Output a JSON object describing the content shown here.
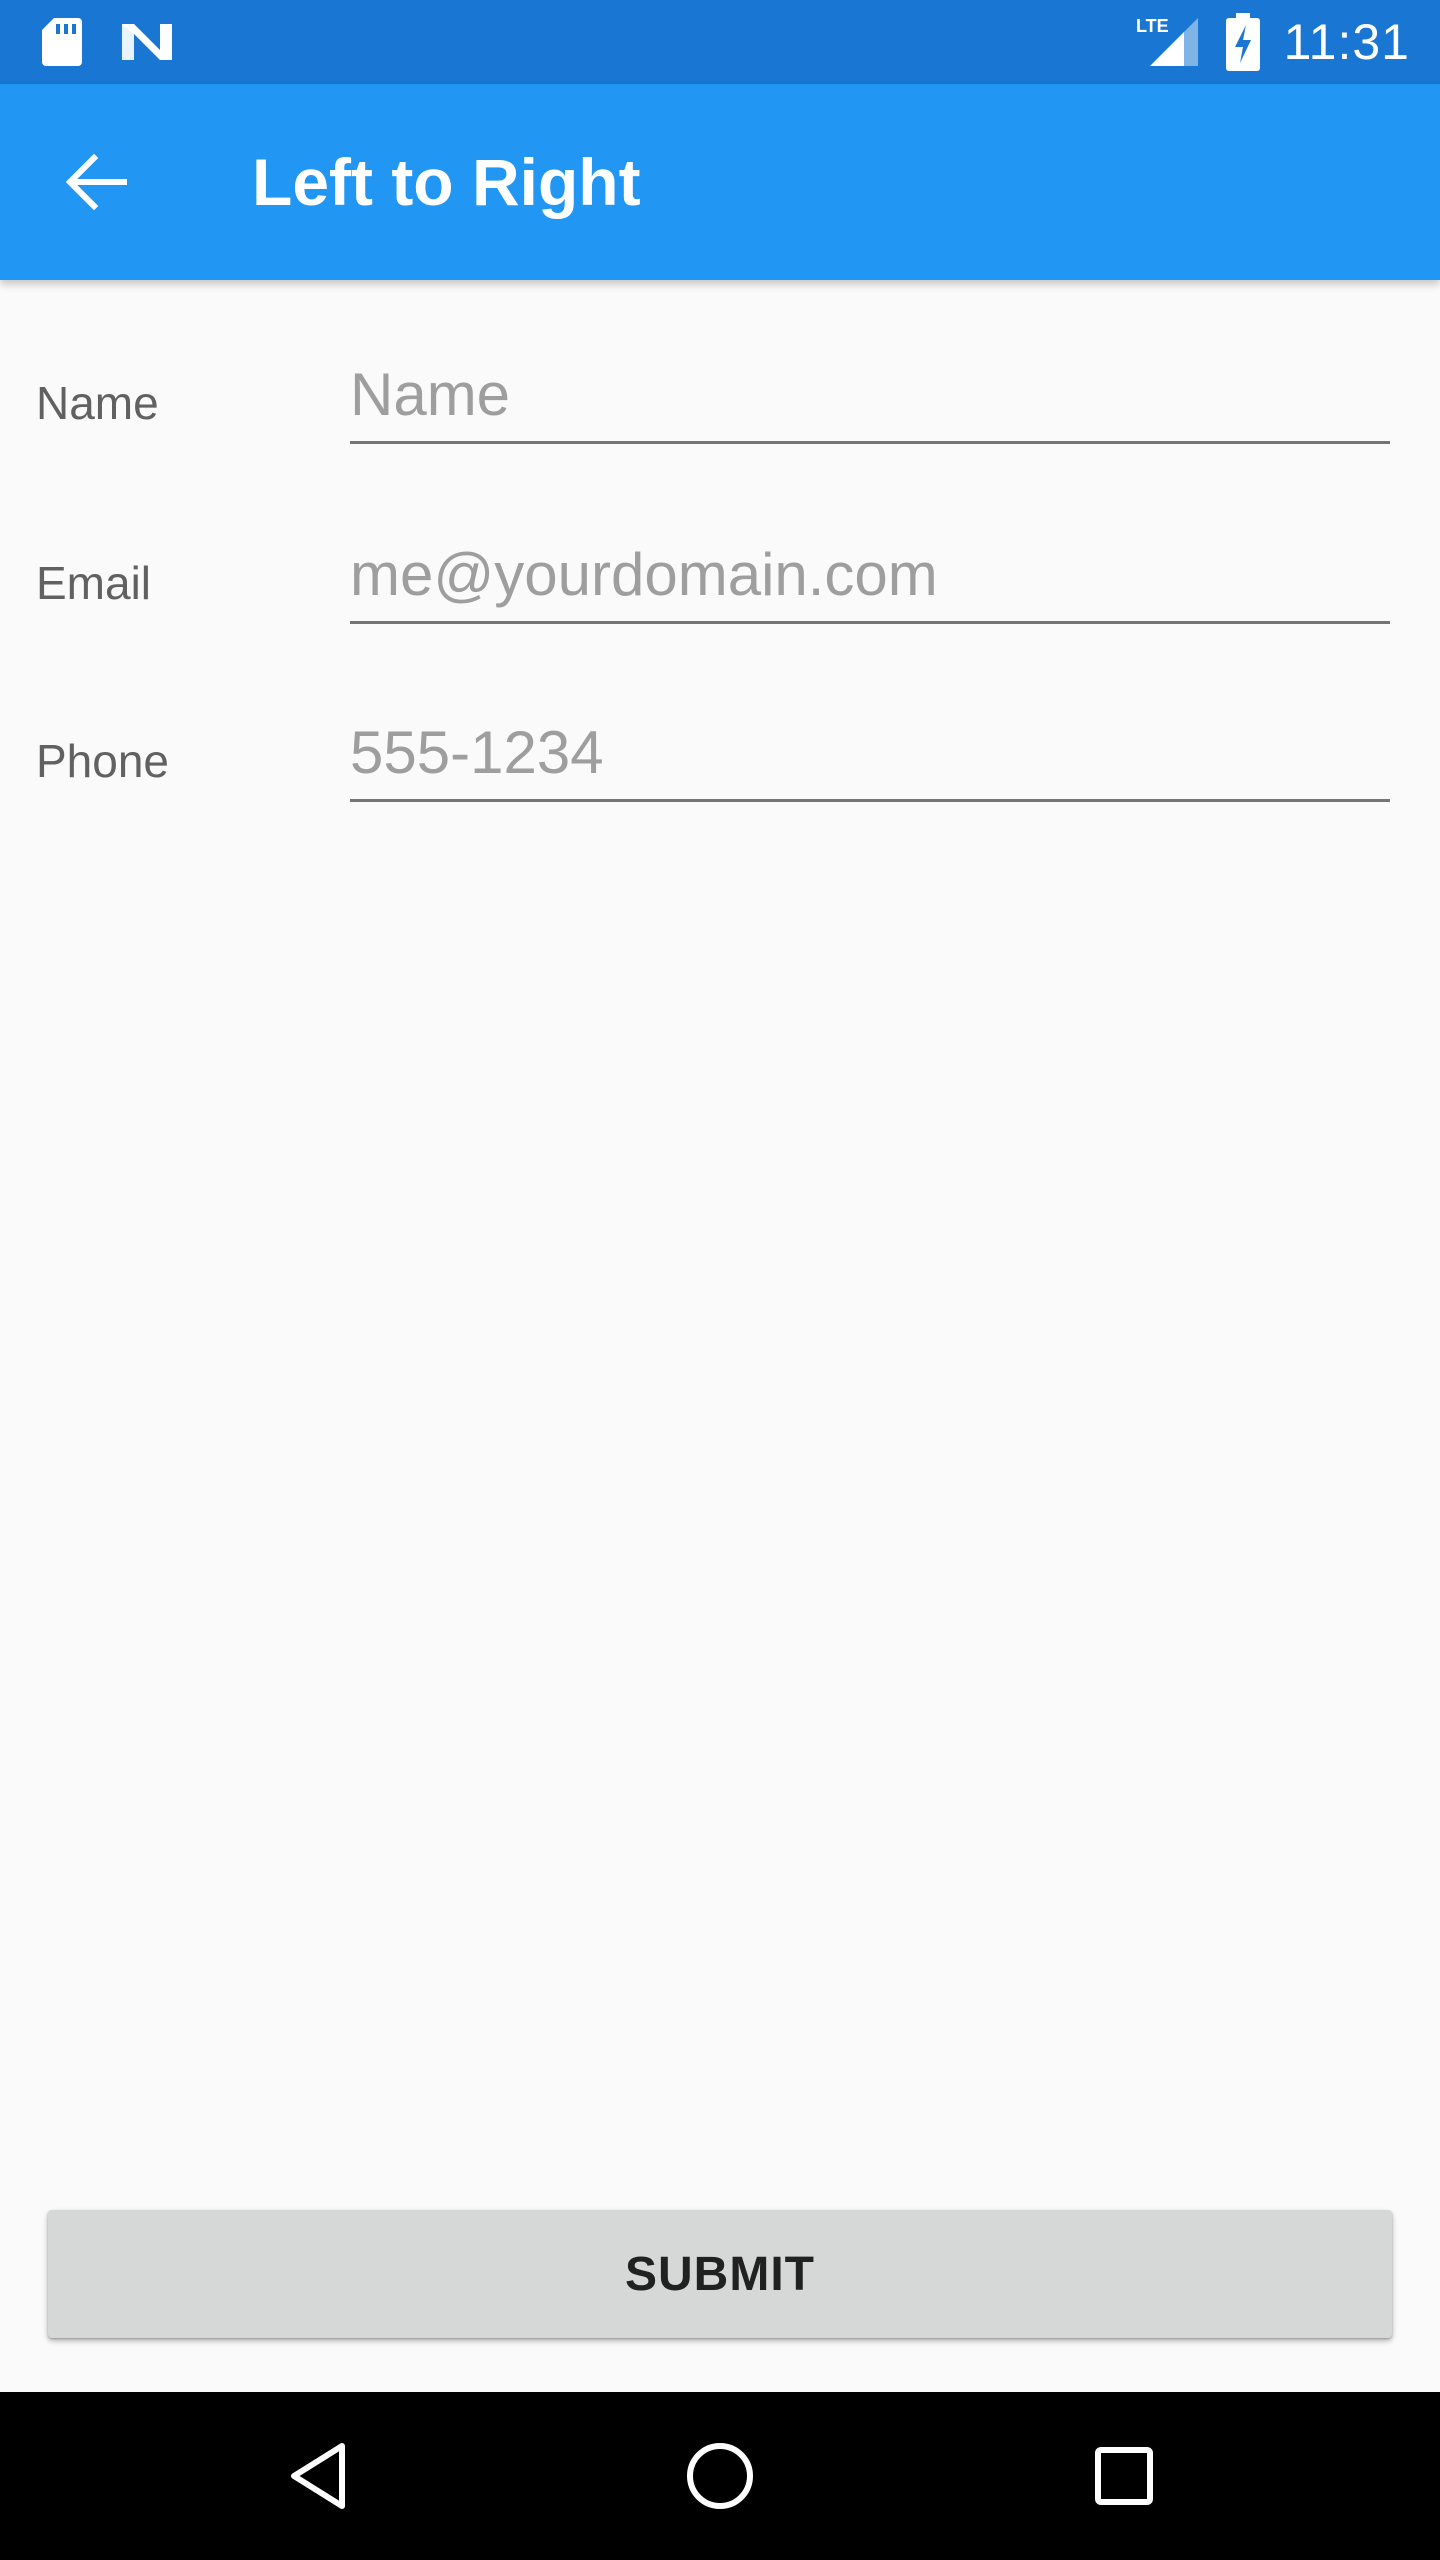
{
  "status_bar": {
    "time": "11:31",
    "network": "LTE",
    "icons": [
      "sd-card-icon",
      "notification-n-icon",
      "lte-signal-icon",
      "battery-charging-icon"
    ],
    "background": "#1976d2"
  },
  "app_bar": {
    "title": "Left to Right",
    "back_icon": "arrow-back-icon",
    "background": "#2196f3"
  },
  "form": {
    "fields": [
      {
        "label": "Name",
        "placeholder": "Name",
        "value": ""
      },
      {
        "label": "Email",
        "placeholder": "me@yourdomain.com",
        "value": ""
      },
      {
        "label": "Phone",
        "placeholder": "555-1234",
        "value": ""
      }
    ]
  },
  "submit": {
    "label": "SUBMIT"
  },
  "nav_bar": {
    "icons": [
      "back-triangle-icon",
      "home-circle-icon",
      "recents-square-icon"
    ]
  }
}
